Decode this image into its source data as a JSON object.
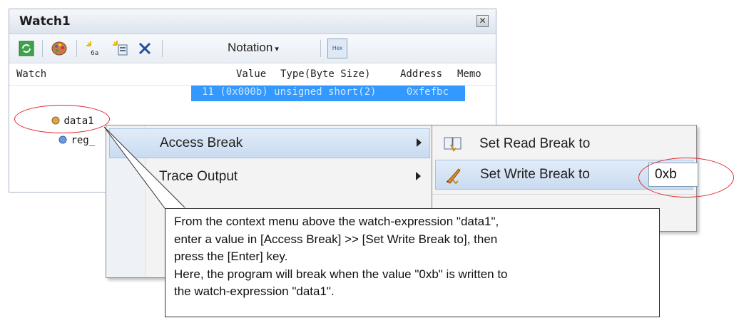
{
  "window": {
    "title": "Watch1"
  },
  "toolbar": {
    "notation_label": "Notation",
    "hex_label": "Hex"
  },
  "table": {
    "headers": {
      "watch": "Watch",
      "value": "Value",
      "type": "Type(Byte Size)",
      "address": "Address",
      "memo": "Memo"
    },
    "rows": [
      {
        "name": "data1",
        "value": "11 (0x000b)",
        "type": "unsigned short(2)",
        "address": "0xfefbc"
      },
      {
        "name": "reg_"
      }
    ]
  },
  "context_menu": {
    "items": [
      {
        "label": "Access Break",
        "has_submenu": true
      },
      {
        "label": "Trace Output",
        "has_submenu": true
      }
    ]
  },
  "submenu": {
    "items": [
      {
        "label": "Set Read Break to"
      },
      {
        "label": "Set Write Break to",
        "input_value": "0xb"
      }
    ]
  },
  "callout": {
    "line1": "From the context menu above the watch-expression \"data1\",",
    "line2": "enter a value in [Access Break] >> [Set Write Break to], then",
    "line3": "press the [Enter] key.",
    "line4": "Here, the program will break when the value \"0xb\" is written to",
    "line5": "the watch-expression \"data1\"."
  },
  "colors": {
    "highlight": "#3399ff",
    "annotation": "#e0272b"
  }
}
